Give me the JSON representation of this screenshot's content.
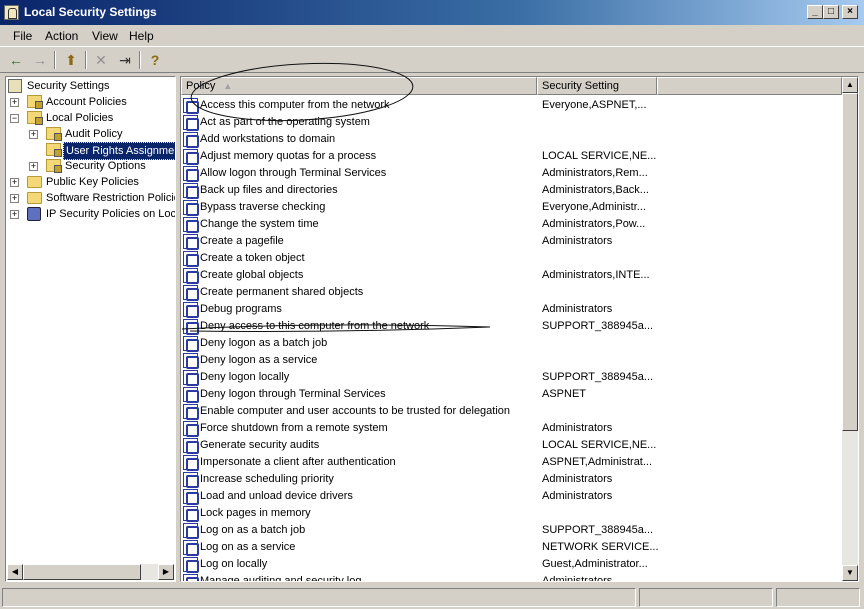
{
  "window": {
    "title": "Local Security Settings",
    "controls": {
      "minimize": "_",
      "maximize": "□",
      "close": "×"
    }
  },
  "menu": [
    "File",
    "Action",
    "View",
    "Help"
  ],
  "toolbar": {
    "back": "←",
    "forward": "→",
    "up": "⬆",
    "delete": "✕",
    "export": "⇥",
    "help": "?"
  },
  "tree": {
    "root": "Security Settings",
    "account_policies": "Account Policies",
    "local_policies": "Local Policies",
    "audit_policy": "Audit Policy",
    "user_rights": "User Rights Assignment",
    "security_options": "Security Options",
    "public_key": "Public Key Policies",
    "software_restriction": "Software Restriction Policies",
    "ip_security": "IP Security Policies on Local Computer",
    "expander_plus": "+",
    "expander_minus": "−"
  },
  "list": {
    "columns": {
      "policy": "Policy",
      "setting": "Security Setting",
      "sort_arrow": "▲"
    },
    "rows": [
      {
        "policy": "Access this computer from the network",
        "setting": "Everyone,ASPNET,..."
      },
      {
        "policy": "Act as part of the operating system",
        "setting": ""
      },
      {
        "policy": "Add workstations to domain",
        "setting": ""
      },
      {
        "policy": "Adjust memory quotas for a process",
        "setting": "LOCAL SERVICE,NE..."
      },
      {
        "policy": "Allow logon through Terminal Services",
        "setting": "Administrators,Rem..."
      },
      {
        "policy": "Back up files and directories",
        "setting": "Administrators,Back..."
      },
      {
        "policy": "Bypass traverse checking",
        "setting": "Everyone,Administr..."
      },
      {
        "policy": "Change the system time",
        "setting": "Administrators,Pow..."
      },
      {
        "policy": "Create a pagefile",
        "setting": "Administrators"
      },
      {
        "policy": "Create a token object",
        "setting": ""
      },
      {
        "policy": "Create global objects",
        "setting": "Administrators,INTE..."
      },
      {
        "policy": "Create permanent shared objects",
        "setting": ""
      },
      {
        "policy": "Debug programs",
        "setting": "Administrators"
      },
      {
        "policy": "Deny access to this computer from the network",
        "setting": "SUPPORT_388945a..."
      },
      {
        "policy": "Deny logon as a batch job",
        "setting": ""
      },
      {
        "policy": "Deny logon as a service",
        "setting": ""
      },
      {
        "policy": "Deny logon locally",
        "setting": "SUPPORT_388945a..."
      },
      {
        "policy": "Deny logon through Terminal Services",
        "setting": "ASPNET"
      },
      {
        "policy": "Enable computer and user accounts to be trusted for delegation",
        "setting": ""
      },
      {
        "policy": "Force shutdown from a remote system",
        "setting": "Administrators"
      },
      {
        "policy": "Generate security audits",
        "setting": "LOCAL SERVICE,NE..."
      },
      {
        "policy": "Impersonate a client after authentication",
        "setting": "ASPNET,Administrat..."
      },
      {
        "policy": "Increase scheduling priority",
        "setting": "Administrators"
      },
      {
        "policy": "Load and unload device drivers",
        "setting": "Administrators"
      },
      {
        "policy": "Lock pages in memory",
        "setting": ""
      },
      {
        "policy": "Log on as a batch job",
        "setting": "SUPPORT_388945a..."
      },
      {
        "policy": "Log on as a service",
        "setting": "NETWORK SERVICE..."
      },
      {
        "policy": "Log on locally",
        "setting": "Guest,Administrator..."
      },
      {
        "policy": "Manage auditing and security log",
        "setting": "Administrators"
      }
    ]
  },
  "scroll": {
    "up": "▲",
    "down": "▼",
    "left": "◀",
    "right": "▶"
  },
  "colors": {
    "titlebar_start": "#0a246a",
    "titlebar_end": "#a6caf0",
    "selection": "#0a246a",
    "window_face": "#d4d0c8"
  }
}
